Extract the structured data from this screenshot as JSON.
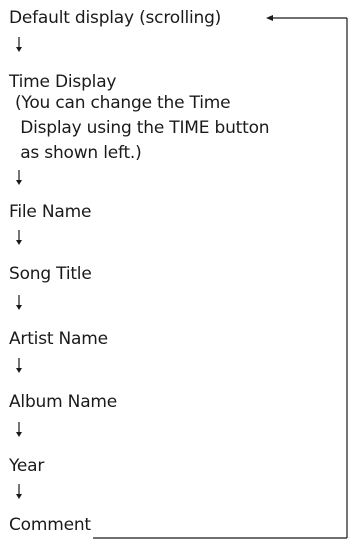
{
  "steps": [
    "Default display (scrolling)",
    "Time Display",
    "File Name",
    "Song Title",
    "Artist Name",
    "Album Name",
    "Year",
    "Comment"
  ],
  "time_display_note": "(You can change the Time\n Display using the TIME button\n as shown left.)"
}
